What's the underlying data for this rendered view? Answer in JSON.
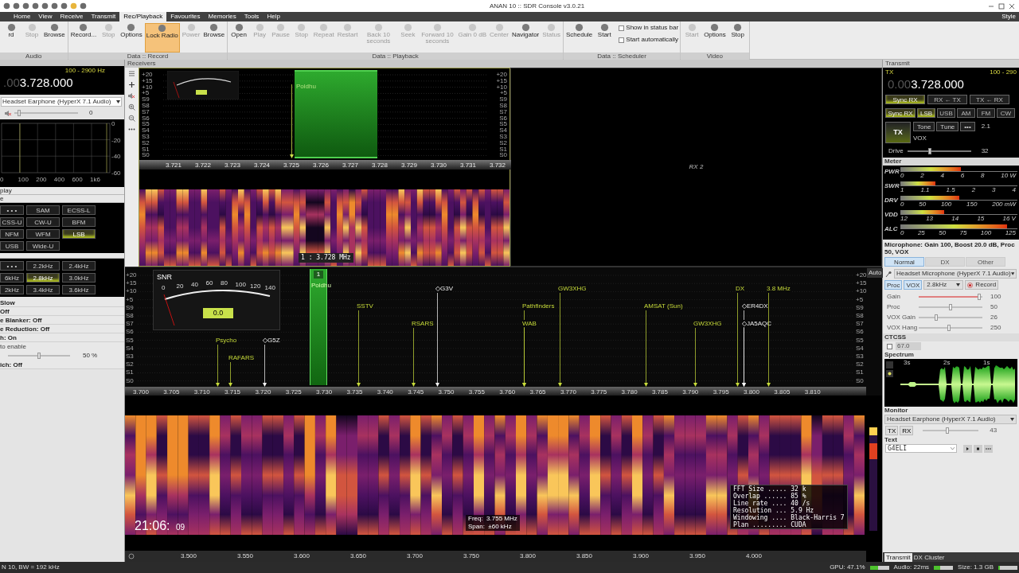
{
  "title_bar": {
    "title": "ANAN 10 :: SDR Console v3.0.21"
  },
  "menu_tabs": [
    {
      "label": "Home",
      "selected": false
    },
    {
      "label": "View",
      "selected": false
    },
    {
      "label": "Receive",
      "selected": false
    },
    {
      "label": "Transmit",
      "selected": false
    },
    {
      "label": "Rec/Playback",
      "selected": true
    },
    {
      "label": "Favourites",
      "selected": false
    },
    {
      "label": "Memories",
      "selected": false
    },
    {
      "label": "Tools",
      "selected": false
    },
    {
      "label": "Help",
      "selected": false
    }
  ],
  "menu_right": "Style",
  "ribbon_groups": [
    {
      "label": "Audio",
      "buttons": [
        {
          "label": "rd",
          "disabled": false,
          "selected": false
        },
        {
          "label": "Stop",
          "disabled": true,
          "selected": false
        },
        {
          "label": "Browse",
          "disabled": false,
          "selected": false
        }
      ]
    },
    {
      "label": "Data :: Record",
      "buttons": [
        {
          "label": "Record...",
          "disabled": false,
          "selected": false
        },
        {
          "label": "Stop",
          "disabled": true,
          "selected": false
        },
        {
          "label": "Options",
          "disabled": false,
          "selected": false
        },
        {
          "label": "Lock Radio",
          "disabled": false,
          "selected": true
        },
        {
          "label": "Power",
          "disabled": true,
          "selected": false
        },
        {
          "label": "Browse",
          "disabled": false,
          "selected": false
        }
      ]
    },
    {
      "label": "Data :: Playback",
      "buttons": [
        {
          "label": "Open",
          "disabled": false,
          "selected": false
        },
        {
          "label": "Play",
          "disabled": true,
          "selected": false
        },
        {
          "label": "Pause",
          "disabled": true,
          "selected": false
        },
        {
          "label": "Stop",
          "disabled": true,
          "selected": false
        },
        {
          "label": "Repeat",
          "disabled": true,
          "selected": false
        },
        {
          "label": "Restart",
          "disabled": true,
          "selected": false
        },
        {
          "label": "Back 10 seconds",
          "disabled": true,
          "selected": false
        },
        {
          "label": "Seek",
          "disabled": true,
          "selected": false
        },
        {
          "label": "Forward 10 seconds",
          "disabled": true,
          "selected": false
        },
        {
          "label": "Gain 0 dB",
          "disabled": true,
          "selected": false
        },
        {
          "label": "Center",
          "disabled": true,
          "selected": false
        },
        {
          "label": "Navigator",
          "disabled": false,
          "selected": false
        },
        {
          "label": "Status",
          "disabled": true,
          "selected": false
        }
      ]
    },
    {
      "label": "Data :: Scheduler",
      "buttons": [
        {
          "label": "Schedule",
          "disabled": false,
          "selected": false
        },
        {
          "label": "Start",
          "disabled": false,
          "selected": false
        }
      ],
      "options": [
        {
          "label": "Show in status bar",
          "checked": false
        },
        {
          "label": "Start automatically",
          "checked": false
        }
      ]
    },
    {
      "label": "Video",
      "buttons": [
        {
          "label": "Start",
          "disabled": true,
          "selected": false
        },
        {
          "label": "Options",
          "disabled": false,
          "selected": false
        },
        {
          "label": "Stop",
          "disabled": false,
          "selected": false
        }
      ]
    }
  ],
  "left_panel": {
    "bandwidth": "100 - 2900 Hz",
    "frequency_prefix": ".00",
    "frequency": "3.728.000",
    "audio_device": "Headset Earphone (HyperX 7.1 Audio)",
    "volume": {
      "level": 0.05,
      "reading": "0"
    },
    "scope": {
      "x_labels": [
        "0",
        "100",
        "200",
        "400",
        "600",
        "1k6"
      ],
      "y_labels": [
        "0",
        "-20",
        "-40",
        "-60"
      ]
    },
    "sections": [
      "play",
      "e"
    ],
    "modes": [
      {
        "label": "• • •",
        "selected": false
      },
      {
        "label": "SAM",
        "selected": false
      },
      {
        "label": "ECSS-L",
        "selected": false
      },
      {
        "label": "CSS-U",
        "selected": false
      },
      {
        "label": "CW-U",
        "selected": false
      },
      {
        "label": "BFM",
        "selected": false
      },
      {
        "label": "NFM",
        "selected": false
      },
      {
        "label": "WFM",
        "selected": false
      },
      {
        "label": "LSB",
        "selected": true
      },
      {
        "label": "USB",
        "selected": false
      },
      {
        "label": "Wide-U",
        "selected": false
      }
    ],
    "filters": [
      {
        "label": "• • •",
        "selected": false
      },
      {
        "label": "2.2kHz",
        "selected": false
      },
      {
        "label": "2.4kHz",
        "selected": false
      },
      {
        "label": "6kHz",
        "selected": false
      },
      {
        "label": "2.8kHz",
        "selected": true
      },
      {
        "label": "3.0kHz",
        "selected": false
      },
      {
        "label": "2kHz",
        "selected": false
      },
      {
        "label": "3.4kHz",
        "selected": false
      },
      {
        "label": "3.6kHz",
        "selected": false
      }
    ],
    "settings": [
      "Slow",
      "Off",
      "e Blanker: Off",
      "e Reduction: Off",
      "h: On"
    ],
    "hint": "to enable",
    "squelch": {
      "level": 0.5,
      "reading": "50 %"
    },
    "last_setting": "ich: Off"
  },
  "receivers_header": "Receivers",
  "rx1": {
    "scale_left": [
      "+20",
      "+15",
      "+10",
      "+5",
      "S9",
      "S8",
      "S7",
      "S6",
      "S5",
      "S4",
      "S3",
      "S2",
      "S1",
      "S0"
    ],
    "scale_right": [
      "+20",
      "+15",
      "+10",
      "+5",
      "S9",
      "S8",
      "S7",
      "S6",
      "S5",
      "S4",
      "S3",
      "S2",
      "S1",
      "S0"
    ],
    "band_label": "Poldhu",
    "axis": [
      "3.721",
      "3.722",
      "3.723",
      "3.724",
      "3.725",
      "3.726",
      "3.727",
      "3.728",
      "3.729",
      "3.730",
      "3.731",
      "3.732"
    ],
    "marker": "1 : 3.728 MHz"
  },
  "rx2": {
    "label": "RX 2"
  },
  "spectrum": {
    "snr": {
      "title": "SNR",
      "ticks": [
        "0",
        "20",
        "40",
        "60",
        "80",
        "100",
        "120",
        "140"
      ],
      "reading": "0.0"
    },
    "channel_badge": "1",
    "band_label": "Poldhu",
    "scale_left": [
      "+20",
      "+15",
      "+10",
      "+5",
      "S9",
      "S8",
      "S7",
      "S6",
      "S5",
      "S4",
      "S3",
      "S2",
      "S1",
      "S0"
    ],
    "scale_right": [
      "+20",
      "+15",
      "+10",
      "+5",
      "S9",
      "S8",
      "S7",
      "S6",
      "S5",
      "S4",
      "S3",
      "S2",
      "S1",
      "S0"
    ],
    "markers": [
      {
        "label": "Psycho",
        "kind": "station"
      },
      {
        "label": "RAFARS",
        "kind": "station"
      },
      {
        "label": "◇G5Z",
        "kind": "spot"
      },
      {
        "label": "SSTV",
        "kind": "station"
      },
      {
        "label": "◇G3V",
        "kind": "spot"
      },
      {
        "label": "RSARS",
        "kind": "station"
      },
      {
        "label": "Pathfinders",
        "kind": "station"
      },
      {
        "label": "WAB",
        "kind": "station"
      },
      {
        "label": "GW3XHG",
        "kind": "station"
      },
      {
        "label": "AMSAT (Sun)",
        "kind": "station"
      },
      {
        "label": "GW3XHG",
        "kind": "station"
      },
      {
        "label": "DX",
        "kind": "station"
      },
      {
        "label": "◇ER4DX",
        "kind": "spot"
      },
      {
        "label": "◇JA5AQC",
        "kind": "spot"
      },
      {
        "label": "3.8 MHz",
        "kind": "station"
      }
    ],
    "axis": [
      "3.700",
      "3.705",
      "3.710",
      "3.715",
      "3.720",
      "3.725",
      "3.730",
      "3.735",
      "3.740",
      "3.745",
      "3.750",
      "3.755",
      "3.760",
      "3.765",
      "3.770",
      "3.775",
      "3.780",
      "3.785",
      "3.790",
      "3.795",
      "3.800",
      "3.805",
      "3.810"
    ],
    "auto_label": "Auto"
  },
  "waterfall": {
    "time": "21:06:",
    "seconds": "09",
    "cursor_info": [
      "Freq:  3.755 MHz",
      "Span:  ±60 kHz"
    ],
    "fft_info": [
      "FFT Size ..... 32 k",
      "Overlap ...... 85 %",
      "Line rate .... 40 /s",
      "Resolution ... 5.9 Hz",
      "Windowing .... Black-Harris 7",
      "Plan ......... CUDA"
    ],
    "axis": [
      "3.500",
      "3.550",
      "3.600",
      "3.650",
      "3.700",
      "3.750",
      "3.800",
      "3.850",
      "3.900",
      "3.950",
      "4.000"
    ]
  },
  "transmit": {
    "header": "Transmit",
    "tx_label": "TX",
    "bandwidth": "100 - 290",
    "frequency_prefix": "0.00",
    "frequency": "3.728.000",
    "sync_buttons": [
      {
        "label": "Sync RX",
        "selected": true
      },
      {
        "label": "RX ← TX",
        "selected": false
      },
      {
        "label": "TX ← RX",
        "selected": false
      }
    ],
    "mode_buttons": [
      {
        "label": "Sync RX",
        "selected": true
      },
      {
        "label": "LSB",
        "selected": true
      },
      {
        "label": "USB",
        "selected": false
      },
      {
        "label": "AM",
        "selected": false
      },
      {
        "label": "FM",
        "selected": false
      },
      {
        "label": "CW",
        "selected": false
      }
    ],
    "tx_button": "TX",
    "tone_buttons": [
      "Tone",
      "Tune",
      "•••"
    ],
    "tone_reading": "2.1",
    "vox_label": "VOX",
    "drive": {
      "label": "Drive",
      "level": 0.35,
      "reading": "32"
    },
    "meter_header": "Meter",
    "meters": [
      {
        "label": "PWR",
        "level": 0.52,
        "scale": [
          "0",
          "2",
          "4",
          "6",
          "8",
          "10 W"
        ]
      },
      {
        "label": "SWR",
        "level": 0.3,
        "scale": [
          "1",
          "1.1",
          "1.5",
          "2",
          "3",
          "4"
        ]
      },
      {
        "label": "DRV",
        "level": 0.51,
        "scale": [
          "0",
          "50",
          "100",
          "150",
          "200 mW"
        ]
      },
      {
        "label": "VDD",
        "level": 0.38,
        "scale": [
          "12",
          "13",
          "14",
          "15",
          "16 V"
        ]
      },
      {
        "label": "ALC",
        "level": 0.92,
        "scale": [
          "0",
          "25",
          "50",
          "75",
          "100",
          "125"
        ]
      }
    ],
    "mic_summary": "Microphone: Gain 100, Boost 20.0 dB, Proc 50, VOX",
    "mic_tabs": [
      {
        "label": "Normal",
        "selected": true
      },
      {
        "label": "DX",
        "selected": false
      },
      {
        "label": "Other",
        "selected": false
      }
    ],
    "mic_device": "Headset Microphone (HyperX 7.1 Audio)",
    "toggles": [
      {
        "label": "Proc",
        "on": true
      },
      {
        "label": "VOX",
        "on": true
      }
    ],
    "filter": "2.8kHz",
    "record": "Record",
    "sliders": [
      {
        "label": "Gain",
        "level": 0.97,
        "reading": "100",
        "kind": "gain"
      },
      {
        "label": "Proc",
        "level": 0.5,
        "reading": "50",
        "kind": "plain"
      },
      {
        "label": "VOX Gain",
        "level": 0.26,
        "reading": "26",
        "kind": "plain"
      },
      {
        "label": "VOX Hang",
        "level": 0.47,
        "reading": "250",
        "kind": "plain"
      }
    ],
    "ctcss_header": "CTCSS",
    "ctcss": {
      "checked": false,
      "value": "67.0"
    },
    "spectrum_header": "Spectrum",
    "spectrum_ticks": [
      "3s",
      "2s",
      "1s"
    ],
    "monitor_header": "Monitor",
    "monitor_device": "Headset Earphone (HyperX 7.1 Audio)",
    "monitor_buttons": [
      "TX",
      "RX"
    ],
    "monitor": {
      "level": 0.43,
      "reading": "43"
    },
    "text_header": "Text",
    "text_value": "G4ELI",
    "bottom_tabs": [
      {
        "label": "Transmit",
        "selected": true
      },
      {
        "label": "DX Cluster",
        "selected": false
      }
    ]
  },
  "status_bar": {
    "left": "N 10, BW = 192 kHz",
    "items": [
      {
        "label": "GPU: 47.1%",
        "level": 0.45
      },
      {
        "label": "Audio: 22ms",
        "level": 0.35
      },
      {
        "label": "Size: 1.3 GB",
        "level": 0.1
      }
    ]
  }
}
